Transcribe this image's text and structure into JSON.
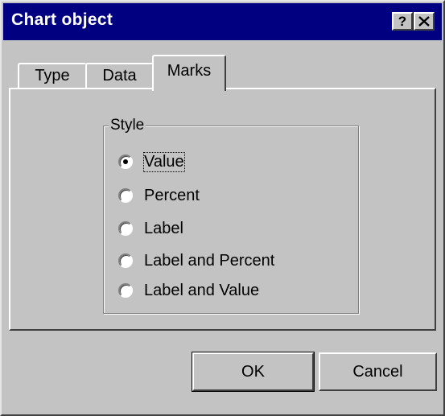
{
  "window": {
    "title": "Chart object",
    "help_label": "?",
    "close_icon": "close-icon"
  },
  "tabs": [
    {
      "label": "Type",
      "selected": false
    },
    {
      "label": "Data",
      "selected": false
    },
    {
      "label": "Marks",
      "selected": true
    }
  ],
  "style_group": {
    "label": "Style",
    "selected_option": "Value",
    "options": [
      {
        "label": "Value",
        "checked": true
      },
      {
        "label": "Percent",
        "checked": false
      },
      {
        "label": "Label",
        "checked": false
      },
      {
        "label": "Label and Percent",
        "checked": false
      },
      {
        "label": "Label and Value",
        "checked": false
      }
    ]
  },
  "buttons": {
    "ok_label": "OK",
    "cancel_label": "Cancel"
  },
  "colors": {
    "titlebar": "#000080",
    "face": "#c3c3c3"
  }
}
